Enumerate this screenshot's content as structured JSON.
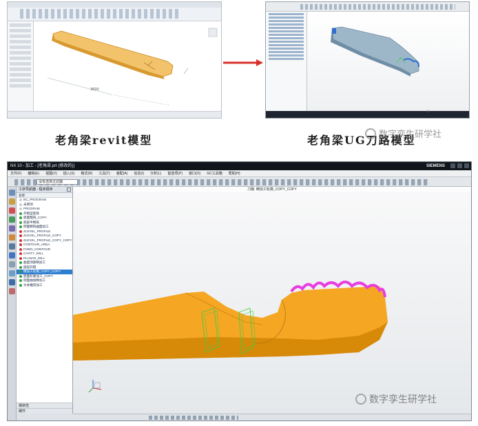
{
  "captions": {
    "left": "老角梁revit模型",
    "right": "老角梁UG刀路模型"
  },
  "watermark": {
    "text": "数字孪生研学社",
    "icon": "wechat-icon"
  },
  "nx": {
    "title": "NX 10 - 加工 - [老角梁.prt (修改的)]",
    "brand": "SIEMENS",
    "menu": [
      "文件(F)",
      "编辑(E)",
      "视图(V)",
      "插入(S)",
      "格式(R)",
      "工具(T)",
      "装配(A)",
      "信息(I)",
      "分析(L)",
      "首选项(P)",
      "窗口(O)",
      "GC工具箱",
      "帮助(H)"
    ],
    "filter_select": "没有选择过滤器",
    "viewport_title": "刀路: 精加工轮廓_COPY_COPY",
    "navigator": {
      "title": "工序导航器 - 程序顺序",
      "column_header": "名称",
      "items": [
        {
          "label": "NC_PROGRAM",
          "status": "none"
        },
        {
          "label": "未用项",
          "status": "none"
        },
        {
          "label": "PROGRAM",
          "status": "none"
        },
        {
          "label": "开粗型腔铣",
          "status": "ok"
        },
        {
          "label": "底面粗铣_COPY",
          "status": "ok"
        },
        {
          "label": "底部半精铣",
          "status": "ok"
        },
        {
          "label": "侧面精铣曲面加工",
          "status": "ok"
        },
        {
          "label": "ZLEVEL_PROFILE",
          "status": "err"
        },
        {
          "label": "ZLEVEL_PROFILE_COPY",
          "status": "err"
        },
        {
          "label": "ZLEVEL_PROFILE_COPY_COPY",
          "status": "err"
        },
        {
          "label": "CONTOUR_AREA",
          "status": "err"
        },
        {
          "label": "FIXED_CONTOUR",
          "status": "err"
        },
        {
          "label": "CAVITY_MILL",
          "status": "err"
        },
        {
          "label": "PLANAR_MILL",
          "status": "err"
        },
        {
          "label": "曲面顶部精加工",
          "status": "ok"
        },
        {
          "label": "圆弧开粗",
          "status": "ok"
        },
        {
          "label": "精加工轮廓_COPY_COPY",
          "status": "sel"
        },
        {
          "label": "底面轮廓加工_COPY",
          "status": "ok"
        },
        {
          "label": "侧面曲线精加工",
          "status": "ok"
        },
        {
          "label": "文本雕刻加工",
          "status": "ok"
        }
      ],
      "footer": [
        "相依性",
        "细节"
      ]
    }
  },
  "colors": {
    "part_orange": "#F5A623",
    "part_shadow": "#D78908",
    "highlight_magenta": "#E83DE0",
    "toolpath_green": "#3FCF3F",
    "arrow_red": "#D9302B",
    "ug_blue": "#2F6FD1"
  }
}
